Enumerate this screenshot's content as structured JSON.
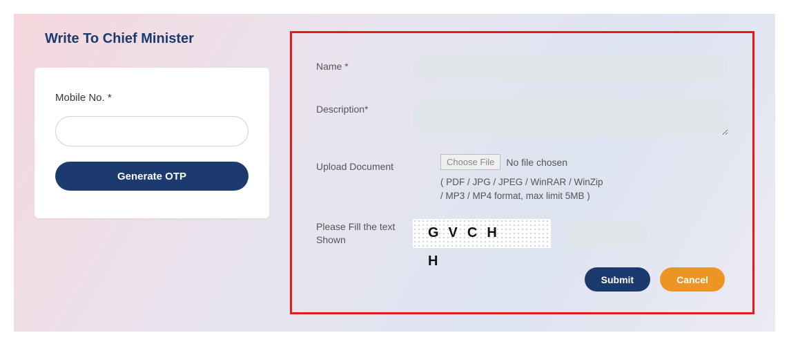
{
  "page": {
    "title": "Write To Chief Minister"
  },
  "otp": {
    "mobile_label": "Mobile No. *",
    "mobile_value": "",
    "generate_label": "Generate OTP"
  },
  "form": {
    "name_label": "Name *",
    "name_value": "",
    "description_label": "Description*",
    "description_value": "",
    "upload_label": "Upload Document",
    "choose_file_label": "Choose File",
    "file_status": "No file chosen",
    "file_hint_line1": "( PDF / JPG / JPEG / WinRAR / WinZip",
    "file_hint_line2": "/ MP3 / MP4 format, max limit 5MB )",
    "captcha_label": "Please Fill the text Shown",
    "captcha_text_row1": "GVCH",
    "captcha_text_row2": "H",
    "captcha_input_value": "",
    "submit_label": "Submit",
    "cancel_label": "Cancel"
  }
}
